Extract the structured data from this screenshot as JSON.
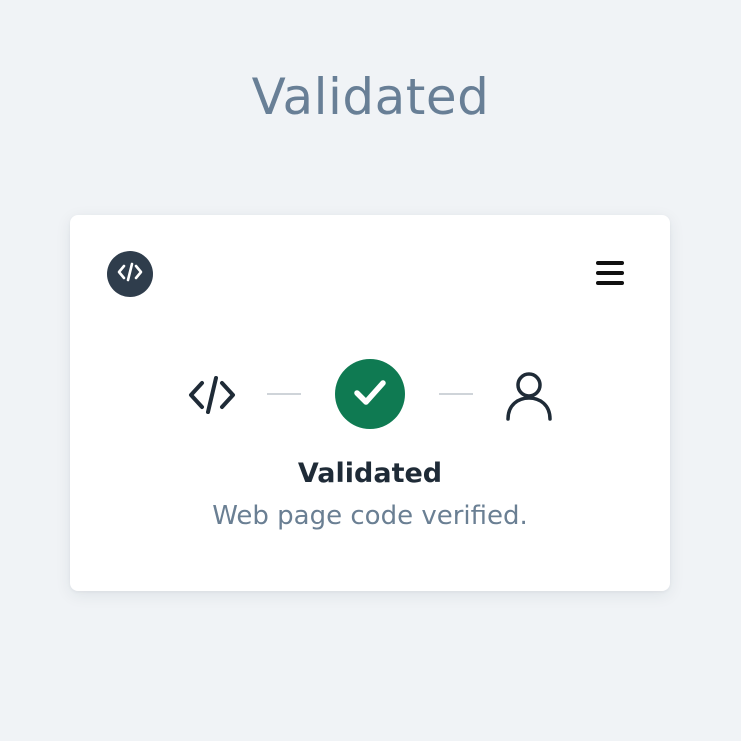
{
  "page": {
    "title": "Validated"
  },
  "card": {
    "logo_icon": "code-icon",
    "menu_icon": "hamburger-menu-icon",
    "steps": [
      {
        "icon": "code-icon",
        "state": "done"
      },
      {
        "icon": "check-icon",
        "state": "current"
      },
      {
        "icon": "user-icon",
        "state": "pending"
      }
    ],
    "status_title": "Validated",
    "status_description": "Web page code verified."
  },
  "colors": {
    "background": "#f0f3f6",
    "page_title": "#687f96",
    "logo_bg": "#2f3d4c",
    "success": "#0f7a52",
    "status_title": "#1f2b37",
    "status_description": "#6a7f93",
    "connector": "#cfd4d9"
  }
}
